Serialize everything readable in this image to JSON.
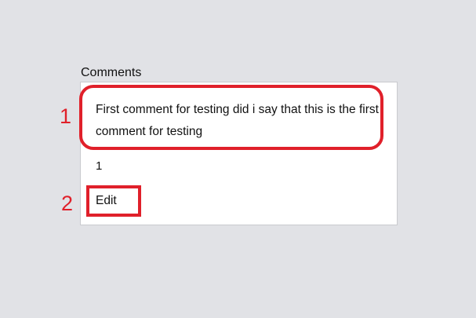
{
  "comments": {
    "title": "Comments",
    "items": [
      {
        "text": "First comment for testing did i say that this is the first comment for testing",
        "count": "1",
        "edit_label": "Edit"
      }
    ]
  },
  "annotations": {
    "marker_1": "1",
    "marker_2": "2",
    "color": "#e0202a"
  }
}
